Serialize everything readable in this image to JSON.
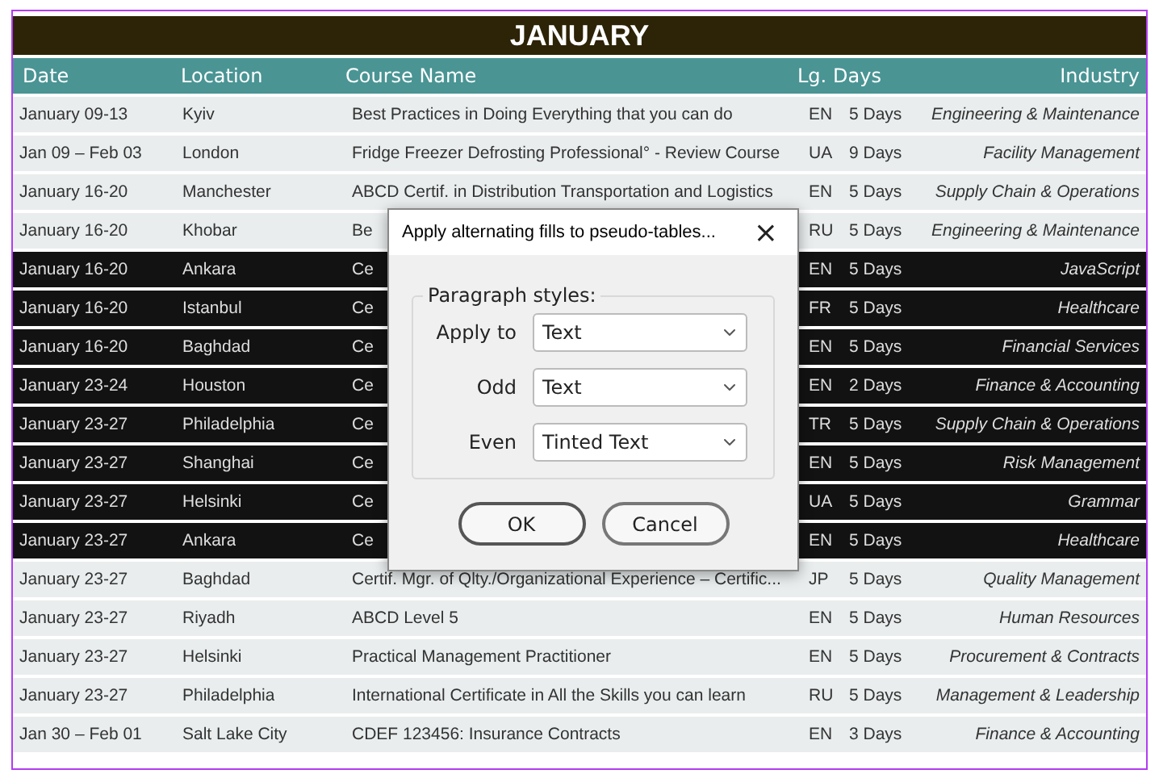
{
  "title": "JANUARY",
  "columns": [
    "Date",
    "Location",
    "Course Name",
    "Lg.",
    "Days",
    "Industry"
  ],
  "rows": [
    {
      "date": "January 09-13",
      "location": "Kyiv",
      "course": "Best Practices in Doing Everything that you can do",
      "lang": "EN",
      "days": "5 Days",
      "industry": "Engineering & Maintenance",
      "selected": false
    },
    {
      "date": "Jan 09 – Feb 03",
      "location": "London",
      "course": "Fridge Freezer Defrosting Professional° - Review Course",
      "lang": "UA",
      "days": "9 Days",
      "industry": "Facility Management",
      "selected": false
    },
    {
      "date": "January 16-20",
      "location": "Manchester",
      "course": "ABCD Certif. in Distribution Transportation and Logistics",
      "lang": "EN",
      "days": "5 Days",
      "industry": "Supply Chain & Operations",
      "selected": false
    },
    {
      "date": "January 16-20",
      "location": "Khobar",
      "course": "Be",
      "lang": "RU",
      "days": "5 Days",
      "industry": "Engineering & Maintenance",
      "selected": false
    },
    {
      "date": "January 16-20",
      "location": "Ankara",
      "course": "Ce",
      "lang": "EN",
      "days": "5 Days",
      "industry": "JavaScript",
      "selected": true
    },
    {
      "date": "January 16-20",
      "location": "Istanbul",
      "course": "Ce",
      "lang": "FR",
      "days": "5 Days",
      "industry": "Healthcare",
      "selected": true
    },
    {
      "date": "January 16-20",
      "location": "Baghdad",
      "course": "Ce",
      "lang": "EN",
      "days": "5 Days",
      "industry": "Financial Services",
      "selected": true
    },
    {
      "date": "January 23-24",
      "location": "Houston",
      "course": "Ce",
      "lang": "EN",
      "days": "2 Days",
      "industry": "Finance & Accounting",
      "selected": true
    },
    {
      "date": "January 23-27",
      "location": "Philadelphia",
      "course": "Ce",
      "lang": "TR",
      "days": "5 Days",
      "industry": "Supply Chain & Operations",
      "selected": true
    },
    {
      "date": "January 23-27",
      "location": "Shanghai",
      "course": "Ce",
      "lang": "EN",
      "days": "5 Days",
      "industry": "Risk Management",
      "selected": true
    },
    {
      "date": "January 23-27",
      "location": "Helsinki",
      "course": "Ce",
      "lang": "UA",
      "days": "5 Days",
      "industry": "Grammar",
      "selected": true
    },
    {
      "date": "January 23-27",
      "location": "Ankara",
      "course": "Ce",
      "lang": "EN",
      "days": "5 Days",
      "industry": "Healthcare",
      "selected": true
    },
    {
      "date": "January 23-27",
      "location": "Baghdad",
      "course": "Certif. Mgr. of Qlty./Organizational Experience – Certific...",
      "lang": "JP",
      "days": "5 Days",
      "industry": "Quality Management",
      "selected": false
    },
    {
      "date": "January 23-27",
      "location": "Riyadh",
      "course": "ABCD Level 5",
      "lang": "EN",
      "days": "5 Days",
      "industry": "Human Resources",
      "selected": false
    },
    {
      "date": "January 23-27",
      "location": "Helsinki",
      "course": "Practical Management Practitioner",
      "lang": "EN",
      "days": "5 Days",
      "industry": "Procurement & Contracts",
      "selected": false
    },
    {
      "date": "January 23-27",
      "location": "Philadelphia",
      "course": "International Certificate in All the Skills you can learn",
      "lang": "RU",
      "days": "5 Days",
      "industry": "Management & Leadership",
      "selected": false
    },
    {
      "date": "Jan 30 – Feb 01",
      "location": "Salt Lake City",
      "course": "CDEF 123456: Insurance Contracts",
      "lang": "EN",
      "days": "3 Days",
      "industry": "Finance & Accounting",
      "selected": false
    }
  ],
  "dialog": {
    "title": "Apply alternating fills to pseudo-tables...",
    "close": "×",
    "group": "Paragraph styles:",
    "fields": [
      {
        "label": "Apply to",
        "value": "Text"
      },
      {
        "label": "Odd",
        "value": "Text"
      },
      {
        "label": "Even",
        "value": "Tinted Text"
      }
    ],
    "buttons": [
      "OK",
      "Cancel"
    ]
  }
}
